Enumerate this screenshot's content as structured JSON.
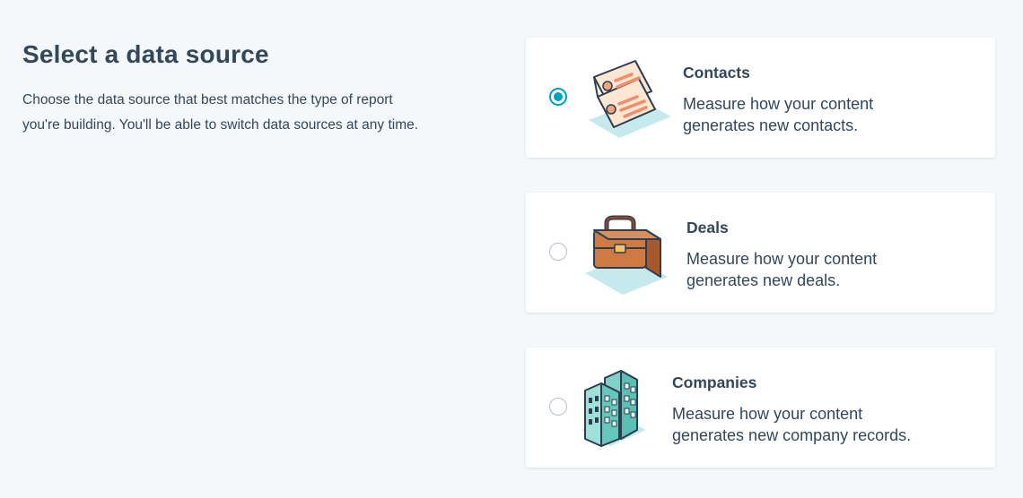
{
  "header": {
    "title": "Select a data source",
    "description_line1": "Choose the data source that best matches the type of report",
    "description_line2": "you're building. You'll be able to switch data sources at any time."
  },
  "sources": [
    {
      "title": "Contacts",
      "description_line1": "Measure how your content",
      "description_line2": "generates new contacts.",
      "selected": true,
      "icon": "contacts-card-icon"
    },
    {
      "title": "Deals",
      "description_line1": "Measure how your content",
      "description_line2": "generates new deals.",
      "selected": false,
      "icon": "briefcase-icon"
    },
    {
      "title": "Companies",
      "description_line1": "Measure how your content",
      "description_line2": "generates new company records.",
      "selected": false,
      "icon": "building-icon"
    }
  ],
  "colors": {
    "background": "#f5f8fa",
    "text": "#33475b",
    "accent": "#00a4bd",
    "radio_border": "#b3c2d0"
  }
}
